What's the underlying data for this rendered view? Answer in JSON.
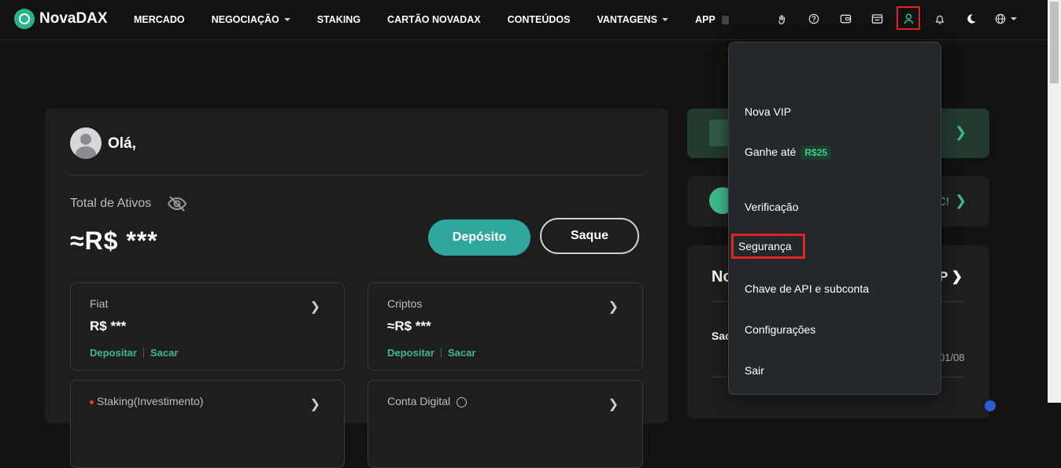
{
  "header": {
    "brand": "NovaDAX",
    "nav": [
      {
        "label": "MERCADO",
        "caret": false
      },
      {
        "label": "NEGOCIAÇÃO",
        "caret": true
      },
      {
        "label": "STAKING",
        "caret": false
      },
      {
        "label": "CARTÃO NOVADAX",
        "caret": false
      },
      {
        "label": "CONTEÚDOS",
        "caret": false
      },
      {
        "label": "VANTAGENS",
        "caret": true
      },
      {
        "label": "APP",
        "caret": false
      }
    ],
    "icons": [
      "hand-icon",
      "help-icon",
      "wallet-icon",
      "orders-icon",
      "user-icon",
      "bell-icon",
      "moon-icon",
      "globe-icon"
    ]
  },
  "account": {
    "greeting": "Olá,",
    "assets_label": "Total de Ativos",
    "assets_value": "≈R$ ***",
    "deposit_label": "Depósito",
    "withdraw_label": "Saque",
    "cards": [
      {
        "title": "Fiat",
        "value": "R$ ***",
        "link1": "Depositar",
        "link2": "Sacar"
      },
      {
        "title": "Criptos",
        "value": "≈R$ ***",
        "link1": "Depositar",
        "link2": "Sacar"
      },
      {
        "title": "Staking(Investimento)"
      },
      {
        "title": "Conta Digital"
      }
    ]
  },
  "right": {
    "discord_tail": "C!",
    "news_title": "No",
    "news_more": "P",
    "news_item": "Sac",
    "news_date": "01/08"
  },
  "menu": {
    "items": [
      {
        "label": "Nova VIP"
      },
      {
        "label": "Ganhe até",
        "badge": "R$25"
      },
      {
        "label": "Verificação"
      },
      {
        "label": "Segurança"
      },
      {
        "label": "Chave de API e subconta"
      },
      {
        "label": "Configurações"
      },
      {
        "label": "Sair"
      }
    ]
  },
  "colors": {
    "accent": "#2fa79c",
    "link": "#3fb98c",
    "highlight_border": "#e02424",
    "background": "#121212",
    "card": "#1e1e1e",
    "menu_bg": "#24282a"
  }
}
